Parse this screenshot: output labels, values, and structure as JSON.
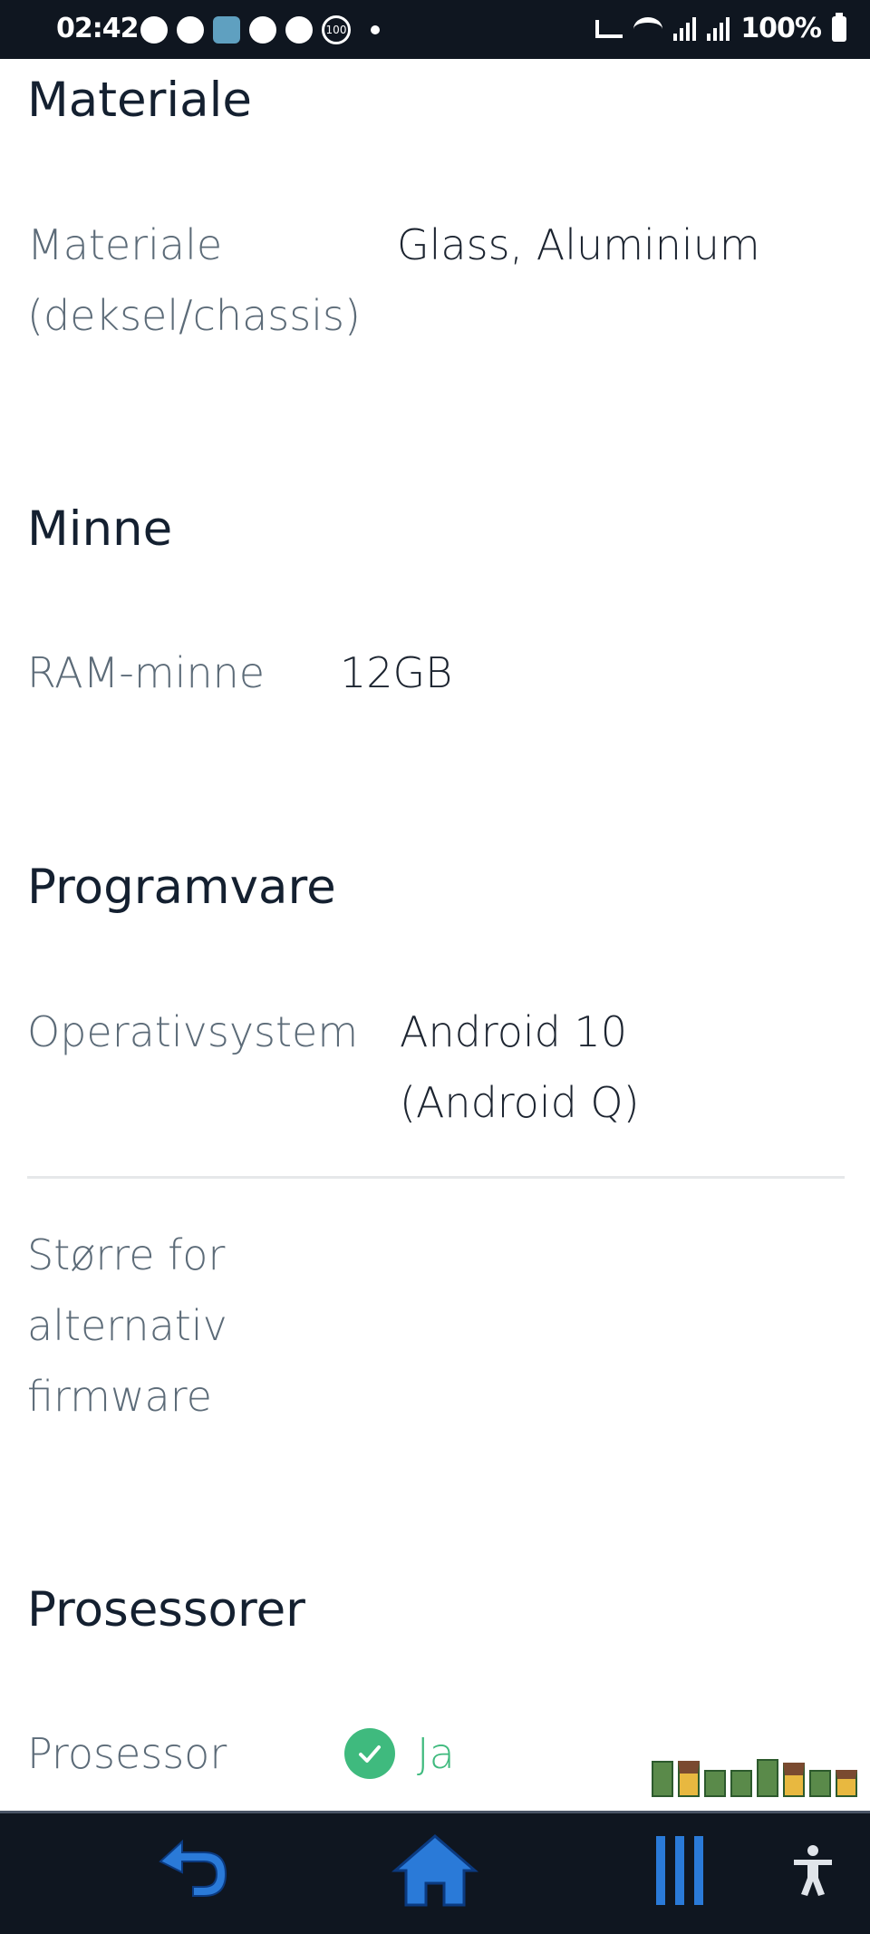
{
  "status_bar": {
    "time": "02:42",
    "battery": "100%",
    "ring_badge": "100"
  },
  "sections": {
    "materiale": {
      "title": "Materiale",
      "label_line1": "Materiale",
      "label_line2": "(deksel/chassis)",
      "value": "Glass, Aluminium"
    },
    "minne": {
      "title": "Minne",
      "label": "RAM-minne",
      "value": "12GB"
    },
    "programvare": {
      "title": "Programvare",
      "label": "Operativsystem",
      "value_line1": "Android 10",
      "value_line2": "(Android Q)",
      "label2_line1": "Større for",
      "label2_line2": "alternativ",
      "label2_line3": "firmware"
    },
    "prosessorer": {
      "title": "Prosessorer",
      "label": "Prosessor",
      "value": "Ja"
    }
  },
  "colors": {
    "status_bar_bg": "#0f1620",
    "heading": "#142030",
    "label": "#5c6b78",
    "accent_green": "#3fba7e",
    "nav_icon_blue": "#2a7ad8"
  },
  "icons": {
    "back": "back-arrow-icon",
    "home": "home-icon",
    "recents": "recent-apps-icon",
    "accessibility": "accessibility-icon",
    "check": "check-circle-icon"
  }
}
